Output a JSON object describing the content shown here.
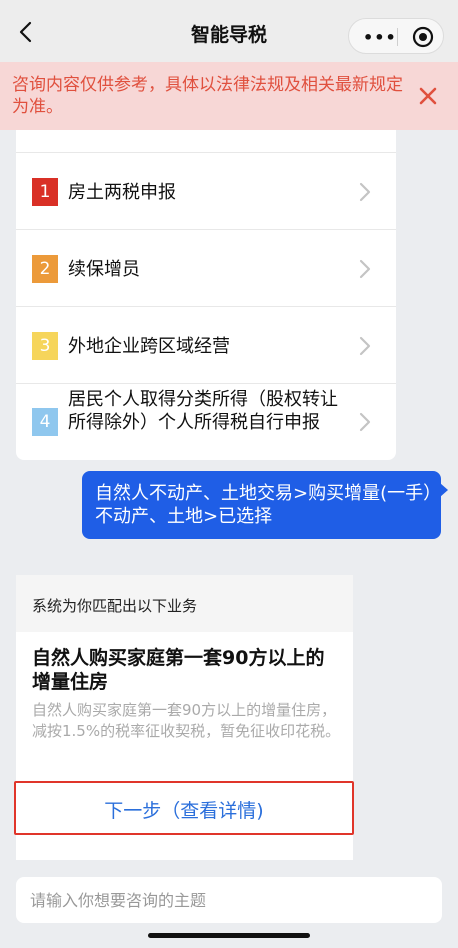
{
  "nav": {
    "title": "智能导税",
    "more_label": "•••"
  },
  "banner": {
    "text": "咨询内容仅供参考，具体以法律法规及相关最新规定为准。"
  },
  "menu": {
    "items": [
      {
        "num": "1",
        "label": "房土两税申报",
        "color": "#d93026"
      },
      {
        "num": "2",
        "label": "续保增员",
        "color": "#ec9a3a"
      },
      {
        "num": "3",
        "label": "外地企业跨区域经营",
        "color": "#f6d55b"
      },
      {
        "num": "4",
        "label": "居民个人取得分类所得（股权转让所得除外）个人所得税自行申报",
        "color": "#8fc7ee"
      }
    ]
  },
  "user_message": {
    "text": "自然人不动产、土地交易>购买增量(一手）不动产、土地>已选择"
  },
  "result": {
    "header": "系统为你匹配出以下业务",
    "title": "自然人购买家庭第一套90方以上的增量住房",
    "description": "自然人购买家庭第一套90方以上的增量住房，减按1.5%的税率征收契税，暂免征收印花税。",
    "next_label": "下一步（查看详情)"
  },
  "input": {
    "placeholder": "请输入你想要咨询的主题",
    "value": ""
  }
}
